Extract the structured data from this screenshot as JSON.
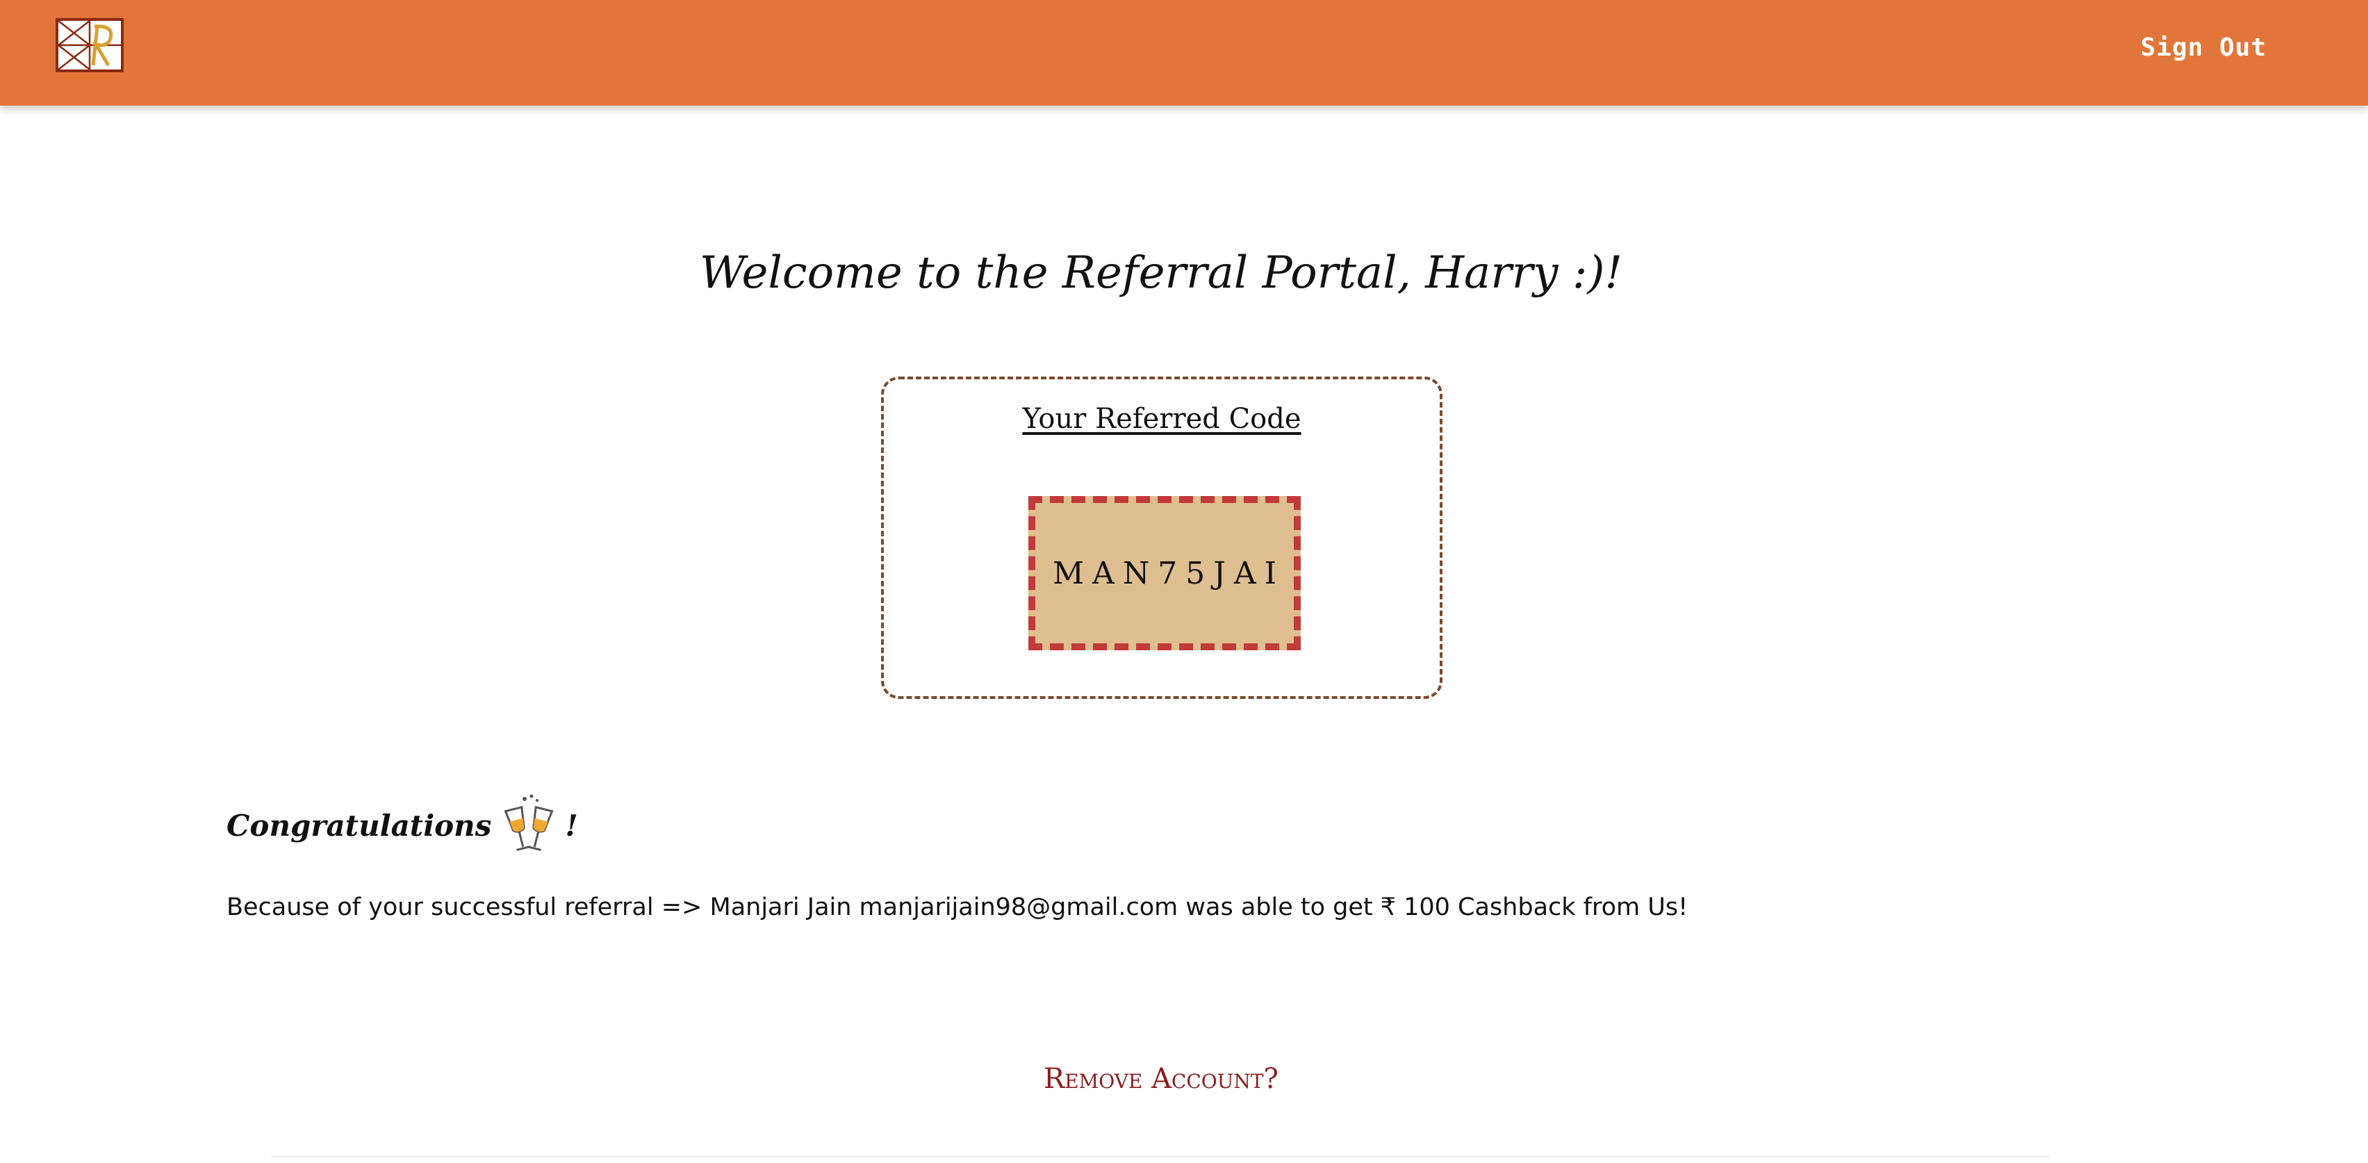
{
  "header": {
    "logo_icon": "brand-logo-icon",
    "signout_label": "Sign Out",
    "brand_color": "#e2763a"
  },
  "welcome": {
    "title": "Welcome to the Referral Portal, Harry :)!"
  },
  "referral_card": {
    "title": "Your Referred Code",
    "code": "MAN75JAI"
  },
  "congrats": {
    "heading": "Congratulations",
    "icon": "champagne-glasses-icon",
    "exclaim": "!",
    "message": "Because of your successful referral => Manjari Jain manjarijain98@gmail.com was able to get ₹ 100 Cashback from Us!"
  },
  "footer": {
    "remove_account_label": "Remove Account?"
  }
}
